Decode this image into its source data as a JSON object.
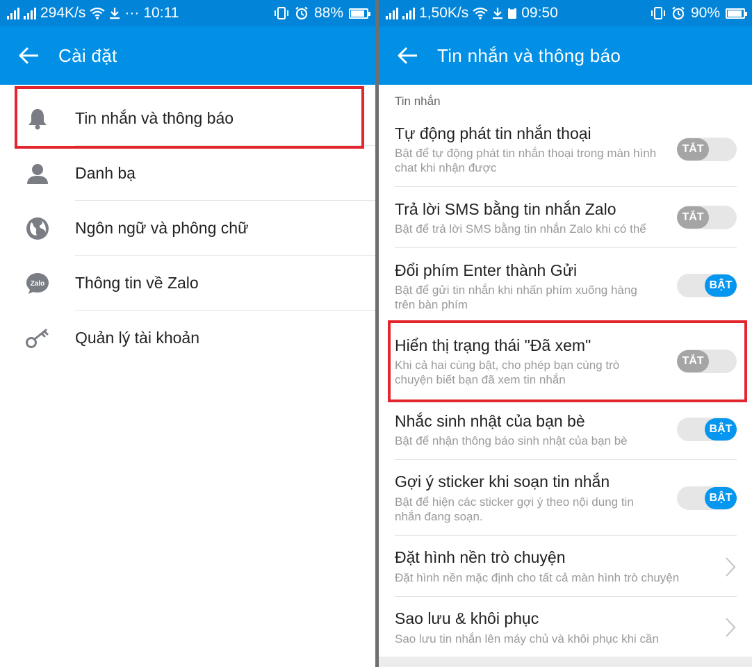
{
  "left": {
    "status": {
      "speed": "294K/s",
      "time": "10:11",
      "battery": "88%",
      "battery_level": 0.88
    },
    "appbar": {
      "title": "Cài đặt"
    },
    "menu": [
      {
        "label": "Tin nhắn và thông báo",
        "icon": "bell-icon"
      },
      {
        "label": "Danh bạ",
        "icon": "person-icon"
      },
      {
        "label": "Ngôn ngữ và phông chữ",
        "icon": "globe-icon"
      },
      {
        "label": "Thông tin về Zalo",
        "icon": "zalo-icon"
      },
      {
        "label": "Quản lý tài khoản",
        "icon": "key-icon"
      }
    ],
    "zalo_icon_text": "Zalo"
  },
  "right": {
    "status": {
      "speed": "1,50K/s",
      "time": "09:50",
      "battery": "90%",
      "battery_level": 0.9
    },
    "appbar": {
      "title": "Tin nhắn và thông báo"
    },
    "section": "Tin nhắn",
    "settings": [
      {
        "title": "Tự động phát tin nhắn thoại",
        "desc": "Bật để tự động phát tin nhắn thoại trong màn hình chat khi nhận được",
        "toggle": "TẮT",
        "on": false
      },
      {
        "title": "Trả lời SMS bằng tin nhắn Zalo",
        "desc": "Bật để trả lời SMS bằng tin nhắn Zalo khi có thể",
        "toggle": "TẮT",
        "on": false
      },
      {
        "title": "Đổi phím Enter thành Gửi",
        "desc": "Bật để gửi tin nhắn khi nhấn phím xuống hàng trên bàn phím",
        "toggle": "BẬT",
        "on": true
      },
      {
        "title": "Hiển thị trạng thái \"Đã xem\"",
        "desc": "Khi cả hai cùng bật, cho phép bạn cùng trò chuyện biết bạn đã xem tin nhắn",
        "toggle": "TẮT",
        "on": false
      },
      {
        "title": "Nhắc sinh nhật của bạn bè",
        "desc": "Bật để nhận thông báo sinh nhật của bạn bè",
        "toggle": "BẬT",
        "on": true
      },
      {
        "title": "Gợi ý sticker khi soạn tin nhắn",
        "desc": "Bật để hiện các sticker gợi ý theo nội dung tin nhắn đang soạn.",
        "toggle": "BẬT",
        "on": true
      },
      {
        "title": "Đặt hình nền trò chuyện",
        "desc": "Đặt hình nền mặc định cho tất cả màn hình trò chuyện",
        "chevron": true
      },
      {
        "title": "Sao lưu & khôi phục",
        "desc": "Sao lưu tin nhắn lên máy chủ và khôi phục khi cần",
        "chevron": true
      }
    ]
  },
  "colors": {
    "primary": "#0290e6",
    "status_bar": "#0285d9",
    "highlight": "#e3262e",
    "toggle_on": "#0596f0",
    "toggle_off": "#a5a5a5"
  }
}
